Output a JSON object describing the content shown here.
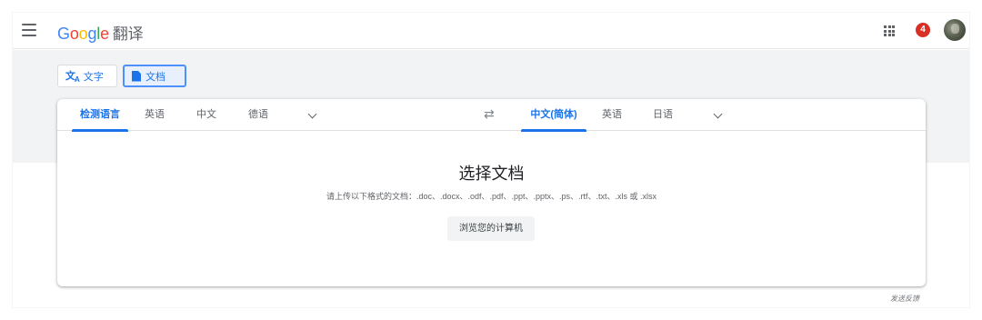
{
  "header": {
    "menu_icon": "hamburger-menu-icon",
    "logo_letters": [
      "G",
      "o",
      "o",
      "g",
      "l",
      "e"
    ],
    "product_name": "翻译",
    "apps_icon": "apps-grid-icon",
    "notification_count": "4",
    "avatar_icon": "user-avatar"
  },
  "modes": {
    "text_icon": "translate-icon",
    "text_label": "文字",
    "document_icon": "document-icon",
    "document_label": "文档",
    "active": "document"
  },
  "source_languages": {
    "tabs": [
      "检测语言",
      "英语",
      "中文",
      "德语"
    ],
    "active_index": 0,
    "more_icon": "chevron-down-icon"
  },
  "swap_icon": "swap-arrows-icon",
  "swap_glyph": "⇄",
  "target_languages": {
    "tabs": [
      "中文(简体)",
      "英语",
      "日语"
    ],
    "active_index": 0,
    "more_icon": "chevron-down-icon"
  },
  "document_panel": {
    "title": "选择文档",
    "hint": "请上传以下格式的文档：.doc、.docx、.odf、.pdf、.ppt、.pptx、.ps、.rtf、.txt、.xls 或 .xlsx",
    "browse_button": "浏览您的计算机"
  },
  "footer": {
    "feedback_link": "发送反馈"
  },
  "colors": {
    "accent": "#1a73e8",
    "badge": "#d93025",
    "page_bg": "#f1f3f4"
  }
}
